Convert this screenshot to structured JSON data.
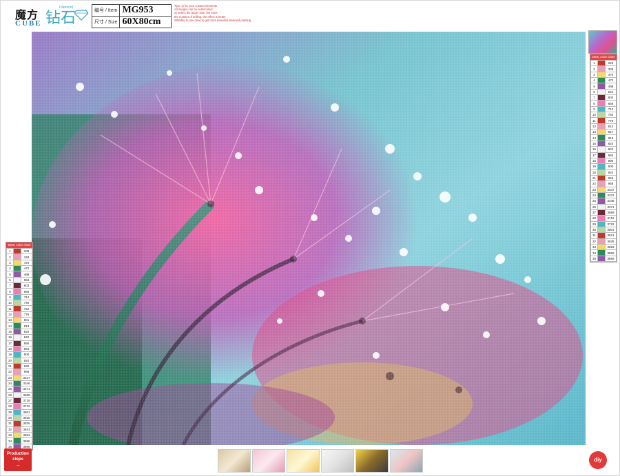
{
  "brand": {
    "name_cn": "魔方",
    "name_en": "CUBE",
    "diamond_cn": "钻石画",
    "diamond_en": "Diamond"
  },
  "product_info": {
    "item_label": "编号 / Item",
    "item_value": "MG953",
    "size_label": "尺寸 / Size",
    "size_value": "60X80cm"
  },
  "notes": [
    "Tips: 1) for your custom elements",
    "All images can be customized",
    "2) Select the larger size, the more",
    "the number of drilling, the effect is better.",
    "Whether to use drew to get more beautiful diamond painting"
  ],
  "legend_header": "DMC color chart",
  "legend_left": {
    "rows": [
      [
        "1",
        "",
        "208"
      ],
      [
        "2",
        "",
        "349"
      ],
      [
        "3",
        "",
        "470"
      ],
      [
        "4",
        "",
        "472"
      ],
      [
        "5",
        "",
        "498"
      ],
      [
        "6",
        "",
        "554"
      ],
      [
        "7",
        "",
        "603"
      ],
      [
        "8",
        "",
        "666"
      ],
      [
        "9",
        "",
        "712"
      ],
      [
        "10",
        "",
        "740"
      ],
      [
        "11",
        "",
        "762"
      ],
      [
        "12",
        "",
        "776"
      ],
      [
        "13",
        "",
        "801"
      ],
      [
        "14",
        "",
        "813"
      ],
      [
        "15",
        "",
        "822"
      ],
      [
        "16",
        "",
        "842"
      ],
      [
        "17",
        "",
        "890"
      ],
      [
        "18",
        "",
        "894"
      ],
      [
        "19",
        "",
        "900"
      ],
      [
        "20",
        "",
        "924"
      ],
      [
        "21",
        "",
        "930"
      ],
      [
        "22",
        "",
        "958"
      ],
      [
        "23",
        "",
        "3347"
      ],
      [
        "24",
        "",
        "3346"
      ],
      [
        "25",
        "",
        "3371"
      ],
      [
        "26",
        "",
        "3689"
      ],
      [
        "27",
        "",
        "3716"
      ],
      [
        "28",
        "",
        "3722"
      ],
      [
        "29",
        "",
        "3801"
      ],
      [
        "30",
        "",
        "3820"
      ],
      [
        "31",
        "",
        "3826"
      ],
      [
        "32",
        "",
        "3843"
      ],
      [
        "33",
        "",
        "3853"
      ],
      [
        "34",
        "",
        "3865"
      ],
      [
        "35",
        "",
        "3866"
      ]
    ]
  },
  "legend_right": {
    "rows": [
      [
        "1",
        "",
        "224"
      ],
      [
        "2",
        "",
        "335"
      ],
      [
        "3",
        "",
        "470"
      ],
      [
        "4",
        "",
        "472"
      ],
      [
        "5",
        "",
        "498"
      ],
      [
        "6",
        "",
        "524"
      ],
      [
        "7",
        "",
        "602"
      ],
      [
        "8",
        "",
        "666"
      ],
      [
        "9",
        "",
        "712"
      ],
      [
        "10",
        "",
        "760"
      ],
      [
        "11",
        "",
        "776"
      ],
      [
        "12",
        "",
        "813"
      ],
      [
        "13",
        "",
        "817"
      ],
      [
        "14",
        "",
        "819"
      ],
      [
        "15",
        "",
        "822"
      ],
      [
        "16",
        "",
        "842"
      ],
      [
        "17",
        "",
        "884"
      ],
      [
        "18",
        "",
        "890"
      ],
      [
        "19",
        "",
        "900"
      ],
      [
        "20",
        "",
        "924"
      ],
      [
        "21",
        "",
        "956"
      ],
      [
        "22",
        "",
        "958"
      ],
      [
        "23",
        "",
        "3347"
      ],
      [
        "24",
        "",
        "3372"
      ],
      [
        "25",
        "",
        "3348"
      ],
      [
        "26",
        "",
        "3371"
      ],
      [
        "27",
        "",
        "3689"
      ],
      [
        "28",
        "",
        "3716"
      ],
      [
        "29",
        "",
        "3722"
      ],
      [
        "30",
        "",
        "3801"
      ],
      [
        "31",
        "",
        "3821"
      ],
      [
        "32",
        "",
        "3826"
      ],
      [
        "33",
        "",
        "3853"
      ],
      [
        "34",
        "",
        "3865"
      ],
      [
        "35",
        "",
        "3866"
      ]
    ]
  },
  "production_steps": {
    "label_line1": "Production",
    "label_line2": "steps",
    "arrow": "→"
  },
  "diy_badge": "diy",
  "colors": {
    "accent_red": "#d62b2b",
    "sky_blue": "#7cc7d6",
    "flower_pink": "#e0508f",
    "stem_green": "#2f7d5a"
  }
}
